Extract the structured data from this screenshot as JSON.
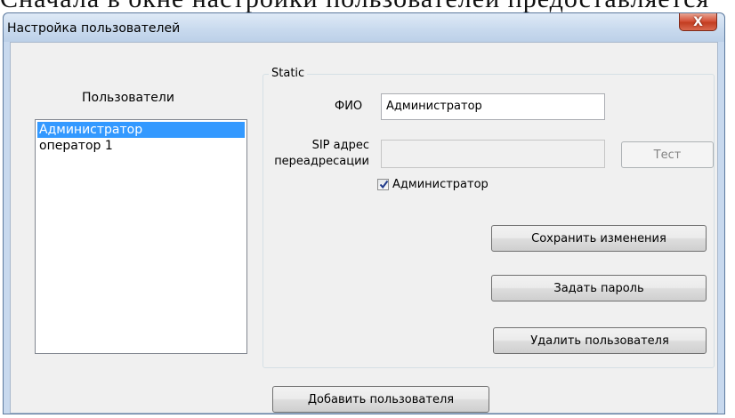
{
  "page_top_text": "Сначала в окне настройки пользователей предоставляется",
  "window": {
    "title": "Настройка пользователей",
    "close_glyph": "X"
  },
  "users": {
    "label": "Пользователи",
    "items": [
      "Администратор",
      "оператор 1"
    ],
    "selected_index": 0
  },
  "group": {
    "title": "Static",
    "fio_label": "ФИО",
    "fio_value": "Администратор",
    "sip_label_line1": "SIP адрес",
    "sip_label_line2": "переадресации",
    "sip_value": "",
    "test_button": "Тест",
    "admin_checkbox_label": "Администратор",
    "admin_checked": true,
    "save_button": "Сохранить изменения",
    "password_button": "Задать пароль",
    "delete_button": "Удалить пользователя"
  },
  "add_user_button": "Добавить пользователя",
  "colors": {
    "selection": "#3399ff",
    "close_button": "#c23d21",
    "titlebar": "#c9daee"
  }
}
